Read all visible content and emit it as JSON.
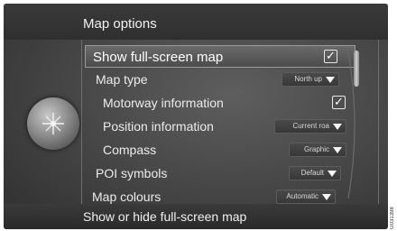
{
  "header": {
    "title": "Map options"
  },
  "menu": {
    "items": [
      {
        "label": "Show full-screen map",
        "control": "checkbox",
        "checked": true,
        "selected": true,
        "indent": 0
      },
      {
        "label": "Map type",
        "control": "dropdown",
        "value": "North up",
        "indent": 1
      },
      {
        "label": "Motorway information",
        "control": "checkbox",
        "checked": true,
        "indent": 2
      },
      {
        "label": "Position information",
        "control": "dropdown",
        "value": "Current roa",
        "indent": 2
      },
      {
        "label": "Compass",
        "control": "dropdown",
        "value": "Graphic",
        "indent": 2
      },
      {
        "label": "POI symbols",
        "control": "dropdown",
        "value": "Default",
        "indent": 1
      },
      {
        "label": "Map colours",
        "control": "dropdown",
        "value": "Automatic",
        "indent": 0
      }
    ],
    "check_glyph": "✓"
  },
  "footer": {
    "help_text": "Show or hide full-screen map"
  },
  "side_code": "G031398",
  "colors": {
    "background": "#444444",
    "text": "#ececec",
    "selection": "#5a5a5a"
  },
  "icons": {
    "knob": "navigation-knob-icon",
    "dropdown": "triangle-down-icon"
  }
}
